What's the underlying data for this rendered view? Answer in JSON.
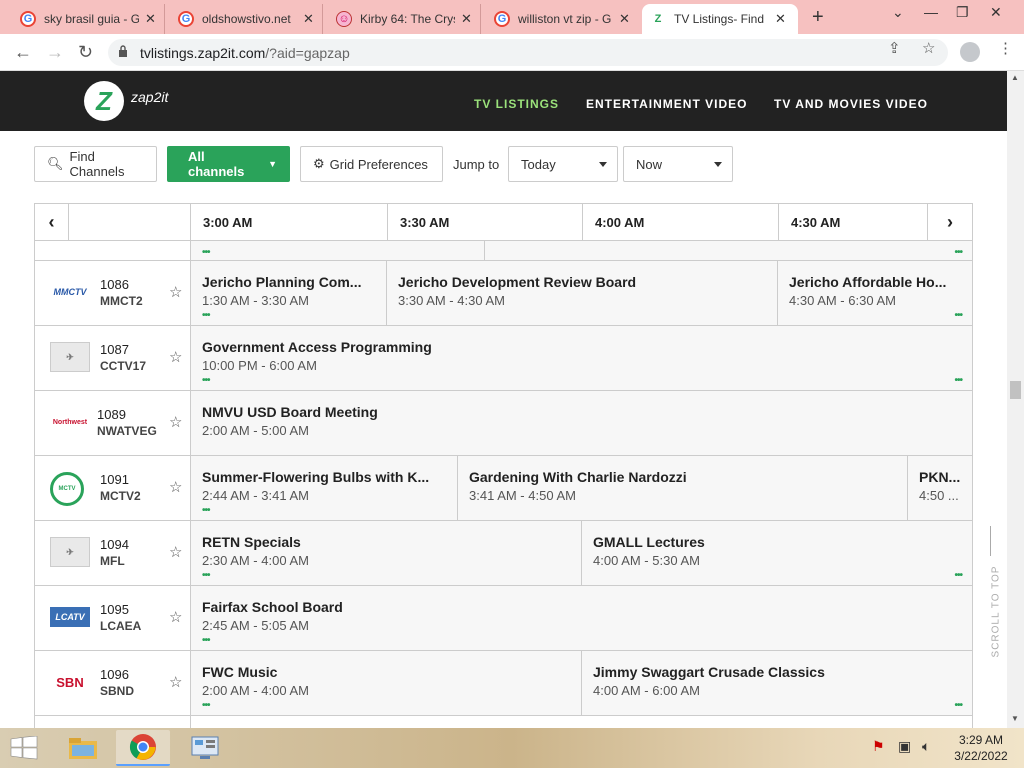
{
  "browser": {
    "tabs": [
      {
        "title": "sky brasil guia - G",
        "icon": "google-icon"
      },
      {
        "title": "oldshowstivo.net",
        "icon": "google-icon"
      },
      {
        "title": "Kirby 64: The Crys",
        "icon": "kirby-icon"
      },
      {
        "title": "williston vt zip - G",
        "icon": "google-icon"
      },
      {
        "title": "TV Listings- Find",
        "icon": "zap2it-icon",
        "active": true
      }
    ],
    "url_host": "tvlistings.zap2it.com",
    "url_path": "/?aid=gapzap"
  },
  "site": {
    "logo_text": "zap2it",
    "nav": [
      {
        "label": "TV LISTINGS",
        "active": true
      },
      {
        "label": "ENTERTAINMENT VIDEO",
        "active": false
      },
      {
        "label": "TV AND MOVIES VIDEO",
        "active": false
      }
    ]
  },
  "controls": {
    "find_channels": "Find Channels",
    "all_channels": "All channels",
    "grid_prefs": "Grid Preferences",
    "jump_to": "Jump to",
    "day": "Today",
    "time": "Now"
  },
  "grid": {
    "timeslots": [
      "3:00 AM",
      "3:30 AM",
      "4:00 AM",
      "4:30 AM"
    ],
    "rows": [
      {
        "number": "1086",
        "call": "MMCT2",
        "logo_text": "MMCTV",
        "programs": [
          {
            "title": "Jericho Planning Com...",
            "time": "1:30 AM - 3:30 AM"
          },
          {
            "title": "Jericho Development Review Board",
            "time": "3:30 AM - 4:30 AM"
          },
          {
            "title": "Jericho Affordable Ho...",
            "time": "4:30 AM - 6:30 AM"
          }
        ]
      },
      {
        "number": "1087",
        "call": "CCTV17",
        "logo_text": "",
        "programs": [
          {
            "title": "Government Access Programming",
            "time": "10:00 PM - 6:00 AM"
          }
        ]
      },
      {
        "number": "1089",
        "call": "NWATVEG",
        "logo_text": "Northwest",
        "programs": [
          {
            "title": "NMVU USD Board Meeting",
            "time": "2:00 AM - 5:00 AM"
          }
        ]
      },
      {
        "number": "1091",
        "call": "MCTV2",
        "logo_text": "",
        "programs": [
          {
            "title": "Summer-Flowering Bulbs with K...",
            "time": "2:44 AM - 3:41 AM"
          },
          {
            "title": "Gardening With Charlie Nardozzi",
            "time": "3:41 AM - 4:50 AM"
          },
          {
            "title": "PKN...",
            "time": "4:50 ..."
          }
        ]
      },
      {
        "number": "1094",
        "call": "MFL",
        "logo_text": "",
        "programs": [
          {
            "title": "RETN Specials",
            "time": "2:30 AM - 4:00 AM"
          },
          {
            "title": "GMALL Lectures",
            "time": "4:00 AM - 5:30 AM"
          }
        ]
      },
      {
        "number": "1095",
        "call": "LCAEA",
        "logo_text": "LCATV",
        "programs": [
          {
            "title": "Fairfax School Board",
            "time": "2:45 AM - 5:05 AM"
          }
        ]
      },
      {
        "number": "1096",
        "call": "SBND",
        "logo_text": "SBN",
        "programs": [
          {
            "title": "FWC Music",
            "time": "2:00 AM - 4:00 AM"
          },
          {
            "title": "Jimmy Swaggart Crusade Classics",
            "time": "4:00 AM - 6:00 AM"
          }
        ]
      }
    ]
  },
  "scroll_to_top": "SCROLL TO TOP",
  "taskbar": {
    "time": "3:29 AM",
    "date": "3/22/2022"
  }
}
